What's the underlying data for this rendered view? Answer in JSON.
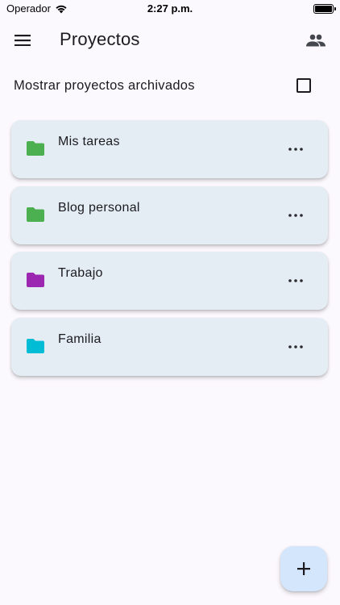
{
  "status_bar": {
    "carrier": "Operador",
    "time": "2:27 p.m."
  },
  "app_bar": {
    "title": "Proyectos",
    "menu_icon": "menu-icon",
    "people_icon": "people-icon"
  },
  "archived_toggle": {
    "label": "Mostrar proyectos archivados",
    "checked": false
  },
  "projects": [
    {
      "name": "Mis tareas",
      "folder_color": "#4caf50"
    },
    {
      "name": "Blog personal",
      "folder_color": "#4caf50"
    },
    {
      "name": "Trabajo",
      "folder_color": "#9c27b0"
    },
    {
      "name": "Familia",
      "folder_color": "#00bcd4"
    }
  ],
  "fab": {
    "icon": "plus-icon"
  },
  "colors": {
    "background": "#fcf9fe",
    "card": "#e4edf4",
    "fab": "#d4e6fb",
    "text": "#1c1b1f"
  }
}
